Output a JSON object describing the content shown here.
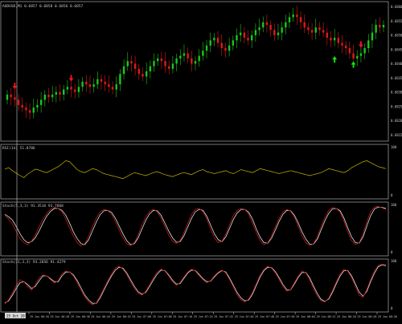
{
  "colors": {
    "background": "#000000",
    "border": "#c8c8c8",
    "grid": "#5a5a5a",
    "bull": "#18c818",
    "bear": "#e01818",
    "rsi": "#c8b400",
    "stoch_main": "#c01818",
    "stoch_signal": "#e0e0e0",
    "up_arrow": "#18e018",
    "down_arrow": "#e81818",
    "text": "#c8c8c8",
    "time_badge_bg": "#d8d8d8",
    "time_badge_text": "#000000"
  },
  "main_panel": {
    "header": "AUDUSD,M1 0.6857 0.6858 0.6856 0.6857",
    "price_labels": [
      "0.6860",
      "0.6855",
      "0.6850",
      "0.6845",
      "0.6840",
      "0.6835",
      "0.6830",
      "0.6825",
      "0.6820",
      "0.6815"
    ],
    "closes": [
      0.683,
      0.6829,
      0.6828,
      0.6826,
      0.6825,
      0.6824,
      0.6823,
      0.6825,
      0.6826,
      0.6828,
      0.683,
      0.6829,
      0.683,
      0.6831,
      0.683,
      0.6832,
      0.6833,
      0.6832,
      0.6831,
      0.6833,
      0.6835,
      0.6834,
      0.6833,
      0.6834,
      0.6836,
      0.6835,
      0.6834,
      0.6833,
      0.6832,
      0.6834,
      0.6838,
      0.6841,
      0.6843,
      0.6842,
      0.684,
      0.6838,
      0.6837,
      0.6839,
      0.6841,
      0.6843,
      0.6844,
      0.6843,
      0.6841,
      0.684,
      0.6842,
      0.6844,
      0.6845,
      0.6846,
      0.6844,
      0.6842,
      0.6843,
      0.6845,
      0.6847,
      0.6849,
      0.6851,
      0.6852,
      0.685,
      0.6848,
      0.6847,
      0.6849,
      0.6851,
      0.6853,
      0.6854,
      0.6852,
      0.6851,
      0.6853,
      0.6855,
      0.6856,
      0.6858,
      0.6857,
      0.6855,
      0.6853,
      0.6854,
      0.6856,
      0.6858,
      0.686,
      0.6861,
      0.686,
      0.6858,
      0.6856,
      0.6855,
      0.6854,
      0.6856,
      0.6855,
      0.6854,
      0.6852,
      0.6851,
      0.6852,
      0.685,
      0.6849,
      0.6848,
      0.6846,
      0.6844,
      0.6845,
      0.6846,
      0.6848,
      0.6851,
      0.6854,
      0.6857,
      0.6856,
      0.6857
    ],
    "signals": [
      {
        "type": "down",
        "bar": 2,
        "price": 0.6834
      },
      {
        "type": "down",
        "bar": 17,
        "price": 0.6837
      },
      {
        "type": "up",
        "bar": 87,
        "price": 0.6843
      },
      {
        "type": "up",
        "bar": 92,
        "price": 0.6841
      },
      {
        "type": "down",
        "bar": 94,
        "price": 0.685
      }
    ]
  },
  "rsi_panel": {
    "header": "RSI(14) 51.8786",
    "level_top": "100",
    "level_bottom": "0",
    "values": [
      55,
      58,
      52,
      47,
      42,
      38,
      45,
      50,
      55,
      53,
      50,
      48,
      52,
      56,
      60,
      66,
      72,
      70,
      62,
      54,
      50,
      48,
      52,
      56,
      54,
      50,
      46,
      44,
      42,
      40,
      38,
      36,
      40,
      44,
      48,
      46,
      44,
      42,
      45,
      48,
      50,
      47,
      44,
      42,
      40,
      43,
      46,
      48,
      46,
      44,
      48,
      52,
      54,
      50,
      48,
      46,
      48,
      50,
      52,
      48,
      46,
      50,
      54,
      52,
      50,
      48,
      52,
      56,
      54,
      52,
      50,
      48,
      46,
      48,
      50,
      52,
      50,
      48,
      46,
      44,
      42,
      44,
      46,
      48,
      52,
      56,
      54,
      52,
      50,
      48,
      52,
      58,
      62,
      66,
      70,
      72,
      68,
      64,
      60,
      58,
      56
    ]
  },
  "stoch1_panel": {
    "header": "Stoch(5,3,3) 91.3516 93.7868",
    "level_top": "100",
    "level_bottom": "0",
    "main": [
      78,
      70,
      60,
      45,
      30,
      22,
      18,
      25,
      38,
      55,
      70,
      82,
      90,
      94,
      92,
      85,
      70,
      52,
      35,
      22,
      15,
      20,
      35,
      55,
      72,
      85,
      90,
      88,
      80,
      65,
      48,
      32,
      20,
      16,
      22,
      38,
      58,
      75,
      86,
      90,
      85,
      72,
      55,
      38,
      25,
      20,
      26,
      42,
      62,
      80,
      90,
      92,
      85,
      70,
      50,
      32,
      22,
      25,
      40,
      60,
      78,
      88,
      92,
      90,
      80,
      62,
      42,
      26,
      18,
      22,
      36,
      55,
      72,
      85,
      90,
      86,
      74,
      55,
      36,
      22,
      16,
      20,
      34,
      55,
      74,
      88,
      94,
      92,
      84,
      66,
      44,
      26,
      18,
      22,
      40,
      65,
      85,
      95,
      96,
      93,
      90
    ],
    "signal": [
      80,
      75,
      68,
      55,
      40,
      28,
      22,
      24,
      32,
      46,
      62,
      76,
      86,
      92,
      92,
      88,
      78,
      62,
      44,
      30,
      20,
      18,
      28,
      46,
      64,
      79,
      87,
      88,
      84,
      72,
      56,
      40,
      26,
      18,
      20,
      32,
      50,
      68,
      81,
      88,
      87,
      78,
      62,
      46,
      32,
      23,
      24,
      36,
      54,
      72,
      85,
      90,
      88,
      76,
      58,
      40,
      28,
      24,
      34,
      52,
      70,
      83,
      90,
      90,
      84,
      70,
      50,
      33,
      22,
      21,
      31,
      48,
      66,
      80,
      88,
      87,
      78,
      62,
      44,
      29,
      19,
      19,
      29,
      48,
      67,
      82,
      91,
      92,
      87,
      72,
      52,
      34,
      22,
      21,
      34,
      56,
      77,
      91,
      95,
      94,
      92
    ]
  },
  "stoch2_panel": {
    "header": "Stoch(21,3,3) 93.2856 91.4279",
    "level_top": "100",
    "level_bottom": "0",
    "main": [
      12,
      20,
      35,
      50,
      62,
      58,
      48,
      40,
      52,
      66,
      72,
      70,
      62,
      55,
      60,
      75,
      80,
      78,
      70,
      56,
      40,
      26,
      16,
      10,
      14,
      28,
      44,
      60,
      74,
      86,
      90,
      84,
      72,
      58,
      44,
      34,
      30,
      38,
      52,
      66,
      78,
      84,
      80,
      70,
      58,
      50,
      56,
      68,
      78,
      84,
      80,
      70,
      62,
      56,
      60,
      70,
      78,
      82,
      76,
      62,
      46,
      30,
      20,
      16,
      22,
      36,
      54,
      72,
      84,
      90,
      86,
      76,
      62,
      48,
      38,
      42,
      56,
      70,
      80,
      76,
      62,
      44,
      28,
      18,
      16,
      24,
      40,
      58,
      74,
      84,
      80,
      66,
      48,
      30,
      26,
      42,
      62,
      80,
      92,
      94,
      93
    ],
    "signal": [
      14,
      18,
      30,
      44,
      56,
      58,
      52,
      44,
      48,
      60,
      70,
      70,
      64,
      58,
      58,
      70,
      78,
      78,
      72,
      60,
      45,
      30,
      20,
      13,
      13,
      24,
      40,
      56,
      70,
      82,
      88,
      86,
      76,
      62,
      48,
      37,
      32,
      36,
      48,
      62,
      74,
      82,
      81,
      72,
      61,
      53,
      54,
      65,
      76,
      82,
      81,
      73,
      64,
      58,
      59,
      68,
      76,
      81,
      78,
      65,
      50,
      35,
      24,
      18,
      20,
      32,
      50,
      68,
      81,
      88,
      87,
      79,
      66,
      52,
      41,
      41,
      53,
      67,
      77,
      77,
      66,
      49,
      33,
      21,
      17,
      22,
      36,
      54,
      70,
      81,
      81,
      70,
      53,
      36,
      28,
      38,
      58,
      76,
      89,
      93,
      91
    ]
  },
  "time_axis": {
    "current_badge": "25 Oct 2019",
    "labels": [
      "29 Jun 06:20",
      "29 Jun 06:28",
      "29 Jun 06:36",
      "29 Jun 06:44",
      "29 Jun 06:52",
      "29 Jun 07:00",
      "29 Jun 07:08",
      "29 Jun 07:16",
      "29 Jun 07:24",
      "29 Jun 07:32",
      "29 Jun 07:40",
      "29 Jun 07:48",
      "29 Jun 07:56",
      "29 Jun 08:04",
      "29 Jun 08:12",
      "29 Jun 08:20",
      "29 Jun 08:28",
      "29 Jun 08:36"
    ]
  }
}
